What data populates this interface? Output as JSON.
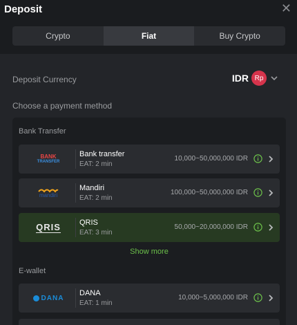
{
  "dialog": {
    "title": "Deposit"
  },
  "tabs": [
    {
      "label": "Crypto",
      "active": false
    },
    {
      "label": "Fiat",
      "active": true
    },
    {
      "label": "Buy Crypto",
      "active": false
    }
  ],
  "currency": {
    "label": "Deposit Currency",
    "code": "IDR",
    "symbol": "Rp"
  },
  "choose_label": "Choose a payment method",
  "groups": [
    {
      "title": "Bank Transfer"
    },
    {
      "title": "E-wallet"
    }
  ],
  "methods": [
    {
      "name": "Bank transfer",
      "eat": "EAT: 2 min",
      "range": "10,000~50,000,000 IDR",
      "logo_top": "BANK",
      "logo_bottom": "TRANSFER"
    },
    {
      "name": "Mandiri",
      "eat": "EAT: 2 min",
      "range": "100,000~50,000,000 IDR",
      "logo_text": "mandiri"
    },
    {
      "name": "QRIS",
      "eat": "EAT: 3 min",
      "range": "50,000~20,000,000 IDR",
      "logo_text": "QRIS"
    },
    {
      "name": "DANA",
      "eat": "EAT: 1 min",
      "range": "10,000~5,000,000 IDR",
      "logo_text": "DANA"
    }
  ],
  "show_more_label": "Show more",
  "colors": {
    "accent_green": "#6cc04a",
    "selected_bg": "#273a22",
    "currency_badge": "#d6344c"
  },
  "icons": {
    "close": "close-icon",
    "chevron": "chevron-down-icon",
    "info": "info-icon",
    "arrow": "chevron-right-icon"
  }
}
